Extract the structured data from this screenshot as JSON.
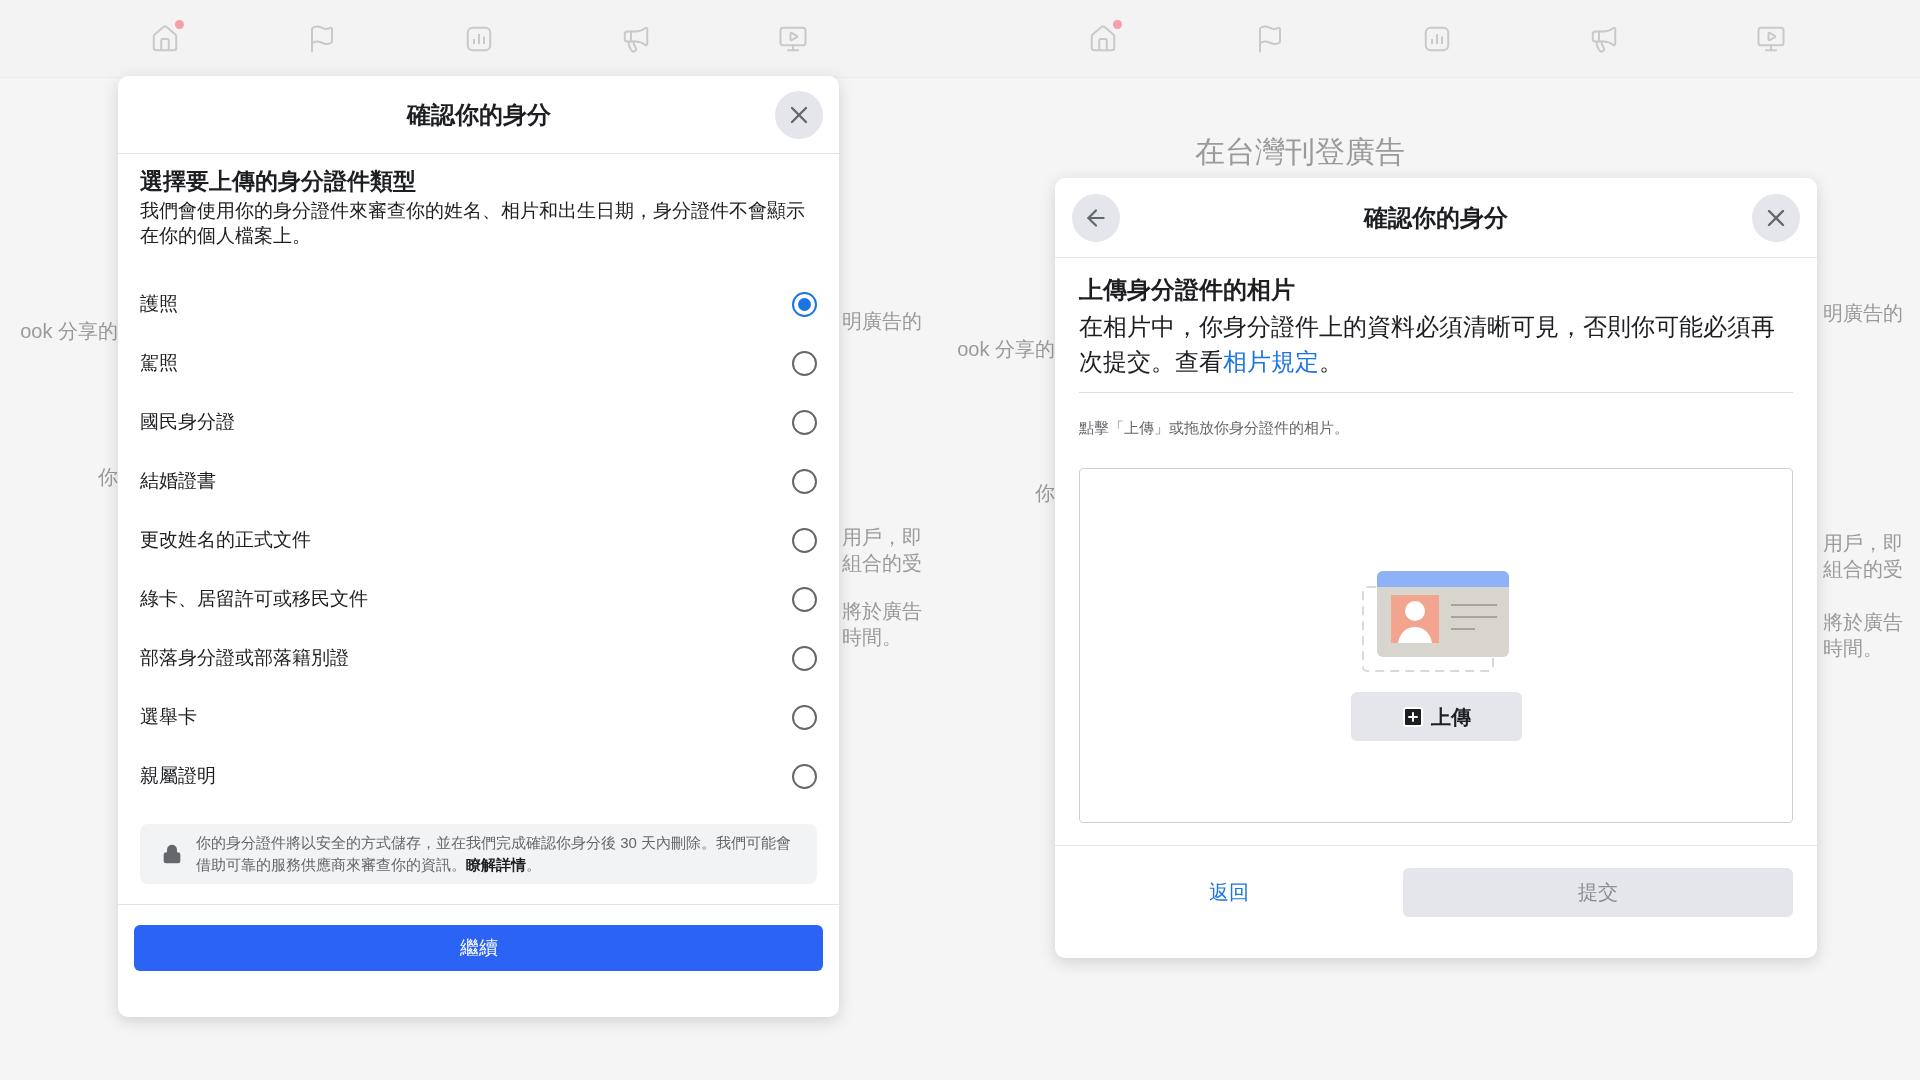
{
  "left_screen": {
    "nav": [
      {
        "notification": true
      },
      {
        "notification": false
      },
      {
        "notification": false
      },
      {
        "notification": false
      },
      {
        "notification": false
      }
    ],
    "background_left": [
      "ook 分享的",
      "你"
    ],
    "background_right": [
      "明廣告的",
      "用戶，即",
      "組合的受",
      "將於廣告",
      "時間。"
    ],
    "dialog": {
      "title": "確認你的身分",
      "heading": "選擇要上傳的身分證件類型",
      "description": "我們會使用你的身分證件來審查你的姓名、相片和出生日期，身分證件不會顯示在你的個人檔案上。",
      "options": [
        {
          "label": "護照",
          "selected": true
        },
        {
          "label": "駕照",
          "selected": false
        },
        {
          "label": "國民身分證",
          "selected": false
        },
        {
          "label": "結婚證書",
          "selected": false
        },
        {
          "label": "更改姓名的正式文件",
          "selected": false
        },
        {
          "label": "綠卡、居留許可或移民文件",
          "selected": false
        },
        {
          "label": "部落身分證或部落籍別證",
          "selected": false
        },
        {
          "label": "選舉卡",
          "selected": false
        },
        {
          "label": "親屬證明",
          "selected": false
        }
      ],
      "notice": {
        "text": "你的身分證件將以安全的方式儲存，並在我們完成確認你身分後 30 天內刪除。我們可能會借助可靠的服務供應商來審查你的資訊。",
        "link": "瞭解詳情",
        "tail": "。"
      },
      "continue_button": "繼續"
    }
  },
  "right_screen": {
    "nav": [
      {
        "notification": true
      },
      {
        "notification": false
      },
      {
        "notification": false
      },
      {
        "notification": false
      },
      {
        "notification": false
      }
    ],
    "page_title": "在台灣刊登廣告",
    "background_left": [
      "ook 分享的",
      "你"
    ],
    "background_right": [
      "明廣告的",
      "用戶，即",
      "組合的受",
      "將於廣告",
      "時間。"
    ],
    "dialog": {
      "title": "確認你的身分",
      "heading": "上傳身分證件的相片",
      "description": {
        "text": "在相片中，你身分證件上的資料必須清晰可見，否則你可能必須再次提交。查看",
        "link": "相片規定",
        "tail": "。"
      },
      "hint": "點擊「上傳」或拖放你身分證件的相片。",
      "upload_button": "上傳",
      "back_button": "返回",
      "submit_button": {
        "label": "提交",
        "disabled": true
      }
    }
  }
}
